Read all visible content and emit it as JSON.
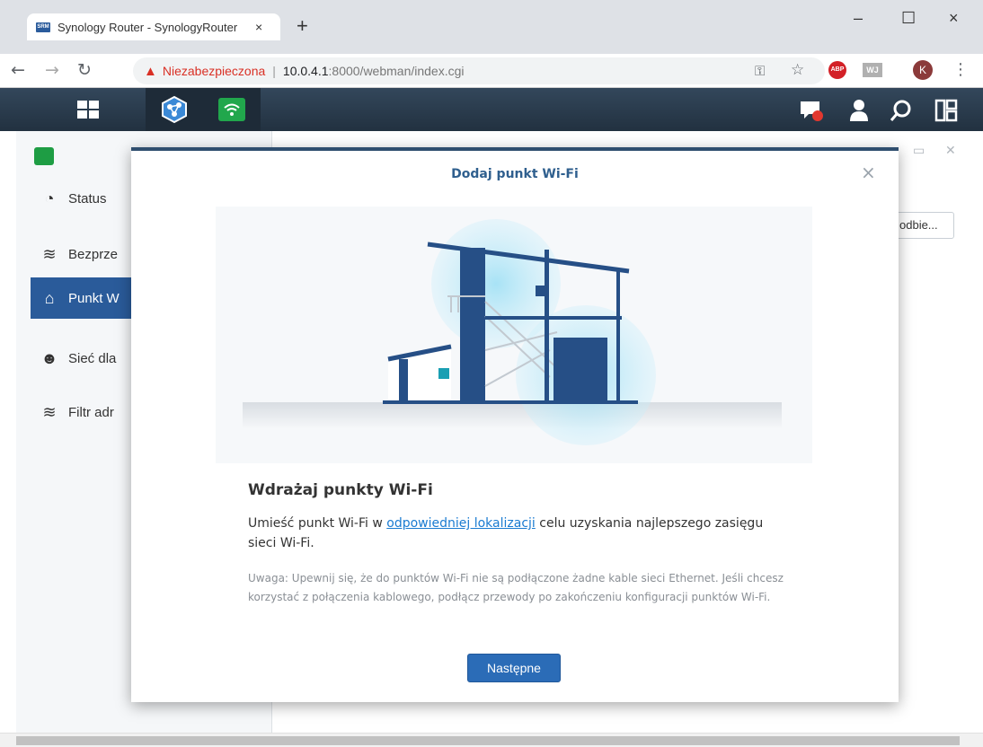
{
  "browser": {
    "tab_title": "Synology Router - SynologyRouter",
    "favicon_text": "SRM",
    "tab_close": "×",
    "new_tab": "+",
    "window_controls": [
      "–",
      "☐",
      "×"
    ],
    "security_label": "Niezabezpieczona",
    "url_host": "10.0.4.1",
    "url_rest": ":8000/webman/index.cgi",
    "avatar_letter": "K",
    "abp_label": "ABP",
    "wj_label": "WJ"
  },
  "sidebar": {
    "items": [
      {
        "label": "Status",
        "icon": "gauge-icon"
      },
      {
        "label": "Bezprze",
        "icon": "wifi-icon"
      },
      {
        "label": "Punkt W",
        "icon": "access-point-icon"
      },
      {
        "label": "Sieć dla",
        "icon": "users-icon"
      },
      {
        "label": "Filtr adr",
        "icon": "wifi-filter-icon"
      }
    ]
  },
  "background": {
    "button_partial": "odbie..."
  },
  "modal": {
    "title": "Dodaj punkt Wi-Fi",
    "close": "×",
    "heading": "Wdrażaj punkty Wi-Fi",
    "para_before": "Umieść punkt Wi-Fi w ",
    "para_link": "odpowiedniej lokalizacji",
    "para_after": " celu uzyskania najlepszego zasięgu sieci Wi-Fi.",
    "note": "Uwaga: Upewnij się, że do punktów Wi-Fi nie są podłączone żadne kable sieci Ethernet. Jeśli chcesz korzystać z połączenia kablowego, podłącz przewody po zakończeniu konfiguracji punktów Wi-Fi.",
    "next_button": "Następne"
  },
  "colors": {
    "taskbar": "#2c3e50",
    "accent": "#2a5b9a",
    "link": "#1a7bd1",
    "button": "#2b6cb7"
  }
}
